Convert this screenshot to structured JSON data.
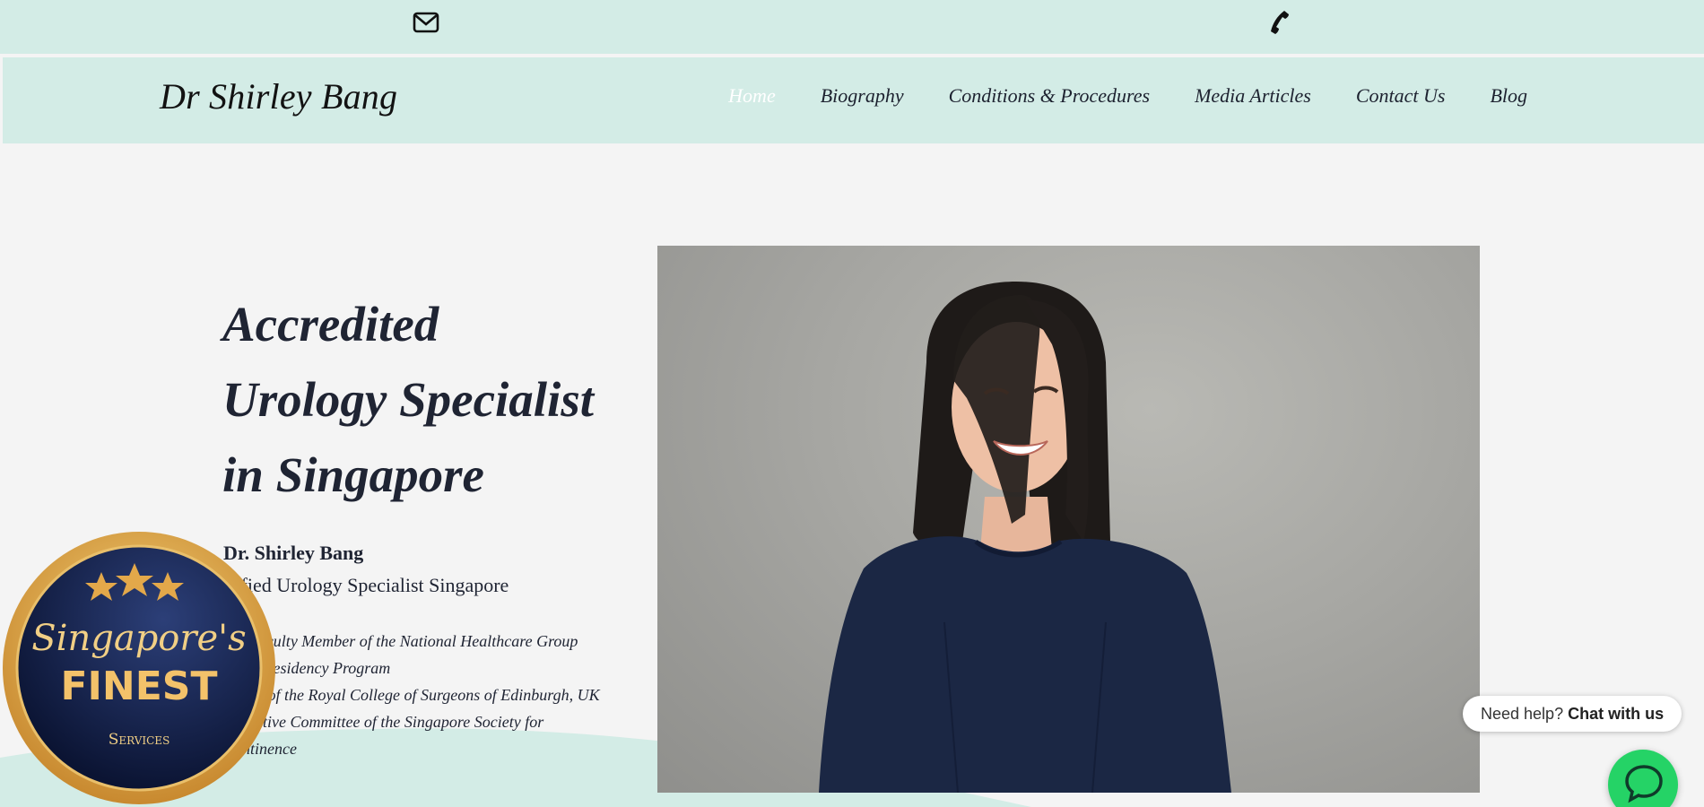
{
  "topbar": {
    "icons": [
      "envelope-icon",
      "phone-icon"
    ]
  },
  "header": {
    "logo": "Dr Shirley Bang",
    "nav": [
      {
        "label": "Home",
        "active": true
      },
      {
        "label": "Biography",
        "active": false
      },
      {
        "label": "Conditions & Procedures",
        "active": false
      },
      {
        "label": "Media Articles",
        "active": false
      },
      {
        "label": "Contact Us",
        "active": false
      },
      {
        "label": "Blog",
        "active": false
      }
    ]
  },
  "hero": {
    "title_lines": [
      "Accredited",
      "Urology Specialist",
      "in Singapore"
    ],
    "doctor_name": "Dr. Shirley Bang",
    "doctor_subtitle": "rtified Urology Specialist Singapore",
    "credentials": [
      "ore Faculty Member of the National Healthcare Group",
      "ology Residency Program",
      "ember of the Royal College of Surgeons of Edinburgh, UK",
      "Executive Committee of the Singapore Society for",
      "Continence"
    ],
    "photo": "portrait-photo"
  },
  "badge": {
    "script": "Singapore's",
    "main": "FINEST",
    "sub": "Services"
  },
  "chat": {
    "prompt": "Need help?",
    "cta": "Chat with us"
  },
  "colors": {
    "mint": "#d3ece6",
    "background": "#f4f4f4",
    "text": "#1f2433",
    "whatsapp": "#25d366",
    "gold": "#d9a24a",
    "navy": "#0f1a3d"
  }
}
